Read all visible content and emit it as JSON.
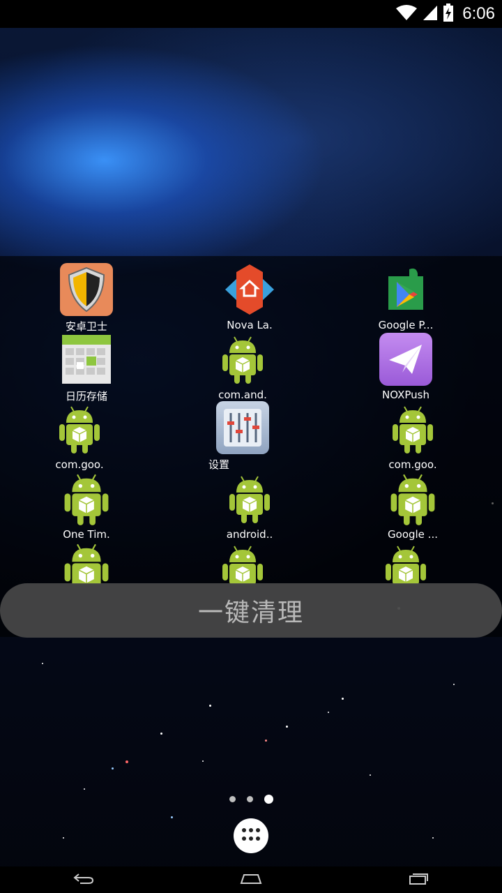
{
  "status_bar": {
    "time": "6:06",
    "icons": [
      "wifi-icon",
      "cell-signal-icon",
      "battery-charging-icon"
    ]
  },
  "apps": [
    {
      "label": "安卓卫士",
      "icon": "shield-icon"
    },
    {
      "label": "Nova La.",
      "icon": "nova-launcher-icon"
    },
    {
      "label": "Google P...",
      "icon": "google-play-services-icon"
    },
    {
      "label": "日历存储",
      "icon": "calendar-icon"
    },
    {
      "label": "com.and.",
      "icon": "android-icon"
    },
    {
      "label": "NOXPush",
      "icon": "paper-plane-icon"
    },
    {
      "label": "com.goo.",
      "icon": "android-icon"
    },
    {
      "label": "设置",
      "icon": "settings-sliders-icon"
    },
    {
      "label": "com.goo.",
      "icon": "android-icon"
    },
    {
      "label": "One Tim.",
      "icon": "android-icon"
    },
    {
      "label": "android..",
      "icon": "android-icon"
    },
    {
      "label": "Google ...",
      "icon": "android-icon"
    },
    {
      "label": "",
      "icon": "android-icon"
    },
    {
      "label": "",
      "icon": "android-icon"
    },
    {
      "label": "",
      "icon": "android-icon"
    }
  ],
  "clean_button": {
    "label": "一键清理"
  },
  "home": {
    "page_count": 3,
    "active_page": 3,
    "all_apps_icon": "app-drawer-icon"
  },
  "nav_bar": {
    "icons": [
      "back-icon",
      "home-icon",
      "recents-icon"
    ]
  },
  "colors": {
    "android_green": "#a4c639",
    "panel_bg": "#000000",
    "clean_button_bg": "#4b4b4b",
    "clean_button_text": "#b9b9b9",
    "nox_purple": "#a76ce0"
  }
}
